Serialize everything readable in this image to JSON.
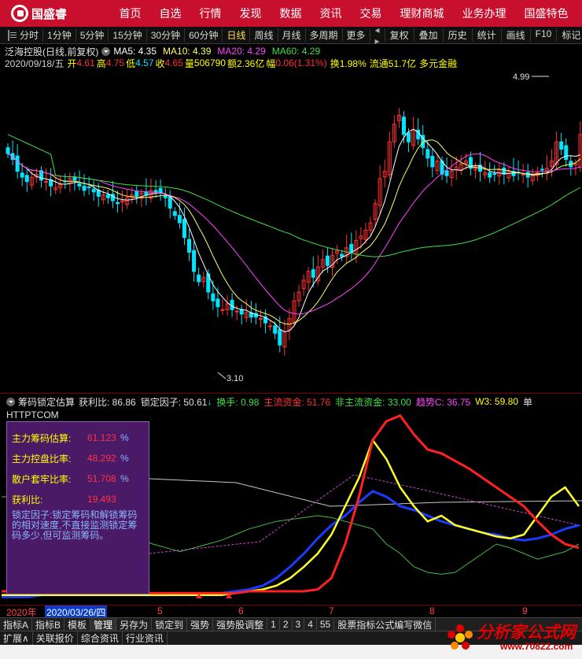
{
  "nav": {
    "logo": "国盛睿",
    "items": [
      "首页",
      "自选",
      "行情",
      "发现",
      "数据",
      "资讯",
      "交易",
      "理财商城",
      "业务办理",
      "国盛特色"
    ]
  },
  "periods": {
    "items": [
      "分时",
      "1分钟",
      "5分钟",
      "15分钟",
      "30分钟",
      "60分钟",
      "日线",
      "周线",
      "月线",
      "多周期",
      "更多"
    ],
    "active": "日线",
    "right": [
      "复权",
      "叠加",
      "历史",
      "统计",
      "画线",
      "F10",
      "标记"
    ]
  },
  "stock": {
    "title": "泛海控股(日线,前复权)",
    "ma5": "MA5: 4.35",
    "ma10": "MA10: 4.39",
    "ma20": "MA20: 4.29",
    "ma60": "MA60: 4.29",
    "date": "2020/09/18/五",
    "open_label": "开",
    "open": "4.61",
    "high_label": "高",
    "high": "4.75",
    "low_label": "低",
    "low": "4.57",
    "close_label": "收",
    "close": "4.65",
    "vol_label": "量",
    "vol": "506790",
    "amt_label": "额",
    "amt": "2.36亿",
    "chg_label": "幅",
    "chg": "0.06(1.31%)",
    "turn": "换1.98%",
    "float": "流通51.7亿",
    "sector": "多元金融",
    "high_mark": "4.99",
    "low_mark": "3.10",
    "flag1": "$",
    "flag2": "财",
    "flag3": "榜"
  },
  "indicator": {
    "name": "筹码锁定估算",
    "profit": "获利比: 86.86",
    "lock": "锁定因子: 50.61",
    "lock_arrow": "↓",
    "turnover": "换手: 0.98",
    "main_fund": "主流资金: 51.76",
    "nonmain_fund": "非主流资金: 33.00",
    "trend": "趋势C: 36.75",
    "w3": "W3: 59.80",
    "more": "单",
    "sub_label": "HTTPTCOM"
  },
  "infobox": {
    "rows": [
      {
        "label": "主力筹码估算:",
        "value": "61.123",
        "pct": "%"
      },
      {
        "label": "主力控盘比率:",
        "value": "48.292",
        "pct": "%"
      },
      {
        "label": "散户套牢比率:",
        "value": "51.708",
        "pct": "%"
      },
      {
        "label": "获利比:",
        "value": "19.493",
        "pct": ""
      }
    ],
    "note": "锁定因子:锁定筹码和解锁筹码的相对速度,不直接监测锁定筹码多少,但可监测筹码。"
  },
  "datebar": {
    "year": "2020年",
    "cursor_date": "2020/03/26/四",
    "months": [
      "5",
      "6",
      "7",
      "8",
      "9"
    ]
  },
  "tabs1": [
    "指标A",
    "指标B",
    "模板",
    "管理",
    "另存为",
    "锁定到",
    "强势",
    "强势股调整",
    "1",
    "2",
    "3",
    "4",
    "55",
    "股票指标公式编写微信"
  ],
  "tabs1_active": "管理",
  "tabs2": [
    "扩展∧",
    "关联报价",
    "综合资讯",
    "行业资讯"
  ],
  "watermark": {
    "title": "分析家公式网",
    "url": "www.70822.com"
  },
  "colors": {
    "up": "#ff3030",
    "down": "#00e5ff",
    "ma5": "#ffffff",
    "ma10": "#ffff66",
    "ma20": "#ff44ff",
    "ma60": "#44dd44"
  },
  "chart_data": {
    "type": "line",
    "candles_close": [
      4.52,
      4.48,
      4.4,
      4.36,
      4.33,
      4.36,
      4.38,
      4.34,
      4.33,
      4.3,
      4.29,
      4.31,
      4.33,
      4.35,
      4.34,
      4.3,
      4.27,
      4.29,
      4.26,
      4.23,
      4.24,
      4.22,
      4.2,
      4.18,
      4.2,
      4.22,
      4.24,
      4.23,
      4.25,
      4.24,
      4.27,
      4.26,
      4.25,
      4.22,
      4.15,
      4.1,
      4.05,
      3.95,
      3.85,
      3.72,
      3.65,
      3.68,
      3.58,
      3.52,
      3.48,
      3.46,
      3.5,
      3.46,
      3.45,
      3.43,
      3.44,
      3.41,
      3.41,
      3.4,
      3.37,
      3.35,
      3.3,
      3.22,
      3.31,
      3.4,
      3.52,
      3.58,
      3.66,
      3.72,
      3.68,
      3.75,
      3.8,
      3.76,
      3.83,
      3.86,
      3.82,
      3.88,
      3.85,
      3.93,
      3.96,
      4.0,
      4.05,
      4.18,
      4.35,
      4.4,
      4.6,
      4.72,
      4.78,
      4.65,
      4.6,
      4.68,
      4.62,
      4.56,
      4.49,
      4.43,
      4.47,
      4.38,
      4.37,
      4.4,
      4.43,
      4.45,
      4.47,
      4.42,
      4.43,
      4.4,
      4.39,
      4.36,
      4.38,
      4.41,
      4.38,
      4.4,
      4.37,
      4.39,
      4.38,
      4.36,
      4.37,
      4.39,
      4.41,
      4.42,
      4.47,
      4.6,
      4.55,
      4.48,
      4.43,
      4.45,
      4.65
    ],
    "main_fund": [
      5,
      5,
      4,
      4,
      4,
      4,
      4,
      4,
      4,
      4,
      4,
      4,
      4,
      4,
      4,
      4,
      4,
      4,
      5,
      5,
      5,
      5,
      5,
      6,
      12,
      30,
      55,
      85,
      95,
      98,
      88,
      80,
      78,
      74,
      70,
      65,
      60,
      55,
      50,
      42,
      35,
      30,
      28
    ],
    "nonmain_fund": [
      2,
      2,
      2,
      3,
      3,
      3,
      3,
      3,
      3,
      3,
      3,
      3,
      3,
      4,
      4,
      4,
      4,
      5,
      6,
      8,
      12,
      18,
      25,
      33,
      40,
      45,
      52,
      58,
      55,
      50,
      48,
      45,
      42,
      40,
      38,
      36,
      35,
      33,
      32,
      33,
      35,
      38,
      40
    ],
    "trend_c": [
      3,
      3,
      3,
      3,
      3,
      3,
      3,
      3,
      3,
      3,
      3,
      3,
      3,
      3,
      3,
      3,
      3,
      4,
      5,
      6,
      8,
      12,
      18,
      25,
      35,
      50,
      65,
      85,
      75,
      60,
      50,
      42,
      45,
      40,
      38,
      36,
      34,
      33,
      35,
      45,
      55,
      60,
      50
    ],
    "w3": [
      55,
      55,
      55,
      54,
      54,
      53,
      50,
      45,
      40,
      36,
      33,
      30,
      28,
      26,
      28,
      30,
      32,
      35,
      38,
      40,
      42,
      43,
      44,
      45,
      44,
      42,
      40,
      38,
      30,
      25,
      18,
      15,
      14,
      15,
      20,
      25,
      30,
      28,
      25,
      22,
      24,
      26,
      30
    ]
  }
}
